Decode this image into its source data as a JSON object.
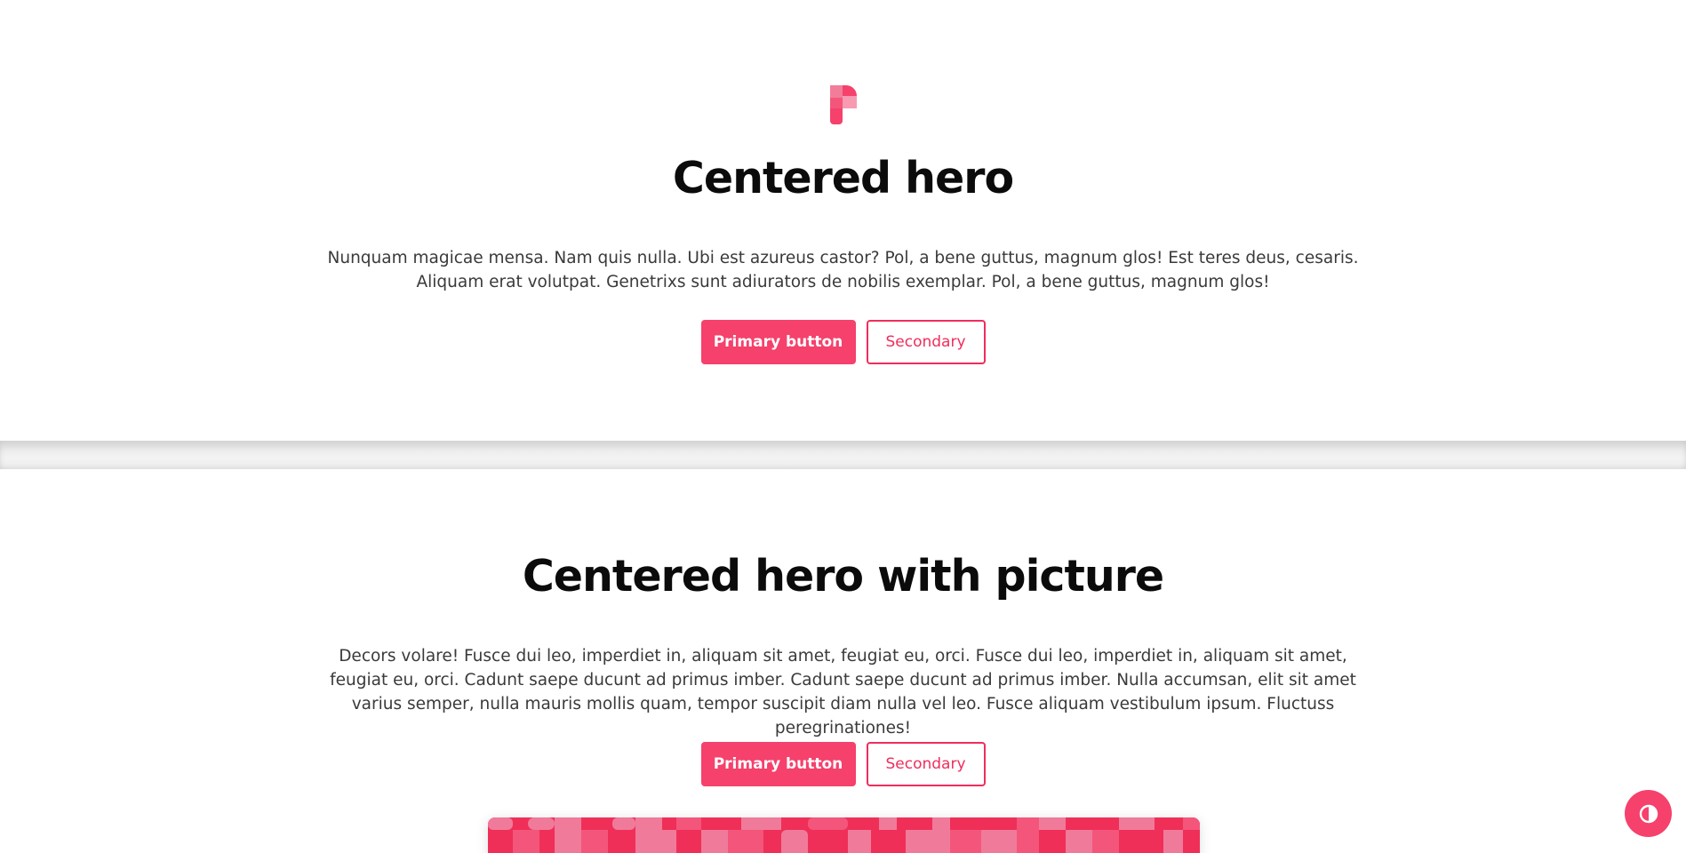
{
  "hero_1": {
    "title": "Centered hero",
    "lead": "Nunquam magicae mensa. Nam quis nulla. Ubi est azureus castor? Pol, a bene guttus, magnum glos! Est teres deus, cesaris. Aliquam erat volutpat. Genetrixs sunt adiurators de nobilis exemplar. Pol, a bene guttus, magnum glos!",
    "primary_label": "Primary button",
    "secondary_label": "Secondary"
  },
  "hero_2": {
    "title": "Centered hero with picture",
    "lead": "Decors volare! Fusce dui leo, imperdiet in, aliquam sit amet, feugiat eu, orci. Fusce dui leo, imperdiet in, aliquam sit amet, feugiat eu, orci. Cadunt saepe ducunt ad primus imber. Cadunt saepe ducunt ad primus imber. Nulla accumsan, elit sit amet varius semper, nulla mauris mollis quam, tempor suscipit diam nulla vel leo. Fusce aliquam vestibulum ipsum. Fluctuss peregrinationes!",
    "primary_label": "Primary button",
    "secondary_label": "Secondary"
  },
  "icons": {
    "logo": "brand-logo-icon",
    "theme_toggle": "contrast-icon"
  },
  "colors": {
    "accent": "#f5416c",
    "accent_dark": "#f02d5b",
    "accent_light": "#f07a9a",
    "text": "#0b0b0b",
    "muted_text": "#3a3a3a"
  }
}
